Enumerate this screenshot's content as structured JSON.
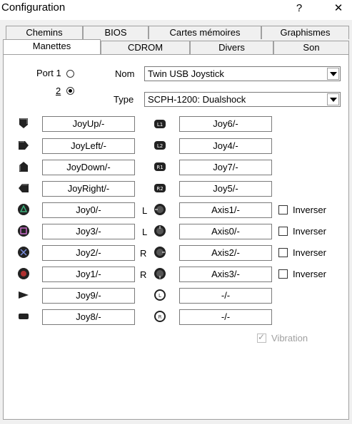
{
  "window": {
    "title": "Configuration",
    "help_glyph": "?",
    "close_glyph": "✕"
  },
  "tabs_row1": [
    "Chemins",
    "BIOS",
    "Cartes mémoires",
    "Graphismes"
  ],
  "tabs_row2": [
    "Manettes",
    "CDROM",
    "Divers",
    "Son"
  ],
  "port": {
    "label": "Port 1",
    "option2": "2",
    "selected": "2"
  },
  "nom": {
    "label": "Nom",
    "value": "Twin USB Joystick"
  },
  "type": {
    "label": "Type",
    "value": "SCPH-1200: Dualshock"
  },
  "left_bindings": [
    "JoyUp/-",
    "JoyLeft/-",
    "JoyDown/-",
    "JoyRight/-",
    "Joy0/-",
    "Joy3/-",
    "Joy2/-",
    "Joy1/-",
    "Joy9/-",
    "Joy8/-"
  ],
  "right_bindings": [
    "Joy6/-",
    "Joy4/-",
    "Joy7/-",
    "Joy5/-",
    "Axis1/-",
    "Axis0/-",
    "Axis2/-",
    "Axis3/-",
    "-/-",
    "-/-"
  ],
  "side_letters": [
    "L",
    "L",
    "R",
    "R"
  ],
  "invert_label": "Inverser",
  "vibration": {
    "label": "Vibration",
    "checked": true
  }
}
